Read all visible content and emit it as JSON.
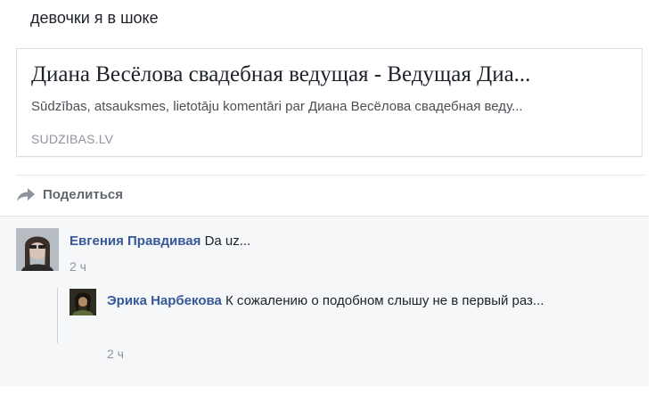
{
  "post": {
    "text": "девочки я в шоке"
  },
  "link_preview": {
    "title": "Диана Весёлова свадебная ведущая - Ведущая Диа...",
    "description": "Sūdzības, atsauksmes, lietotāju komentāri par Диана Весёлова свадебная веду...",
    "domain": "SUDZIBAS.LV"
  },
  "share": {
    "icon": "share-arrow-icon",
    "label": "Поделиться"
  },
  "comments": [
    {
      "author": "Евгения Правдивая",
      "text": "Da uz...",
      "time": "2 ч",
      "avatar": "avatar-photo"
    }
  ],
  "replies": [
    {
      "author": "Эрика Нарбекова",
      "text": "К сожалению о подобном слышу не в первый раз...",
      "time": "2 ч",
      "avatar": "avatar-photo"
    }
  ],
  "colors": {
    "author_link": "#365899",
    "muted": "#90949c",
    "comment_bg": "#f6f7f9"
  }
}
